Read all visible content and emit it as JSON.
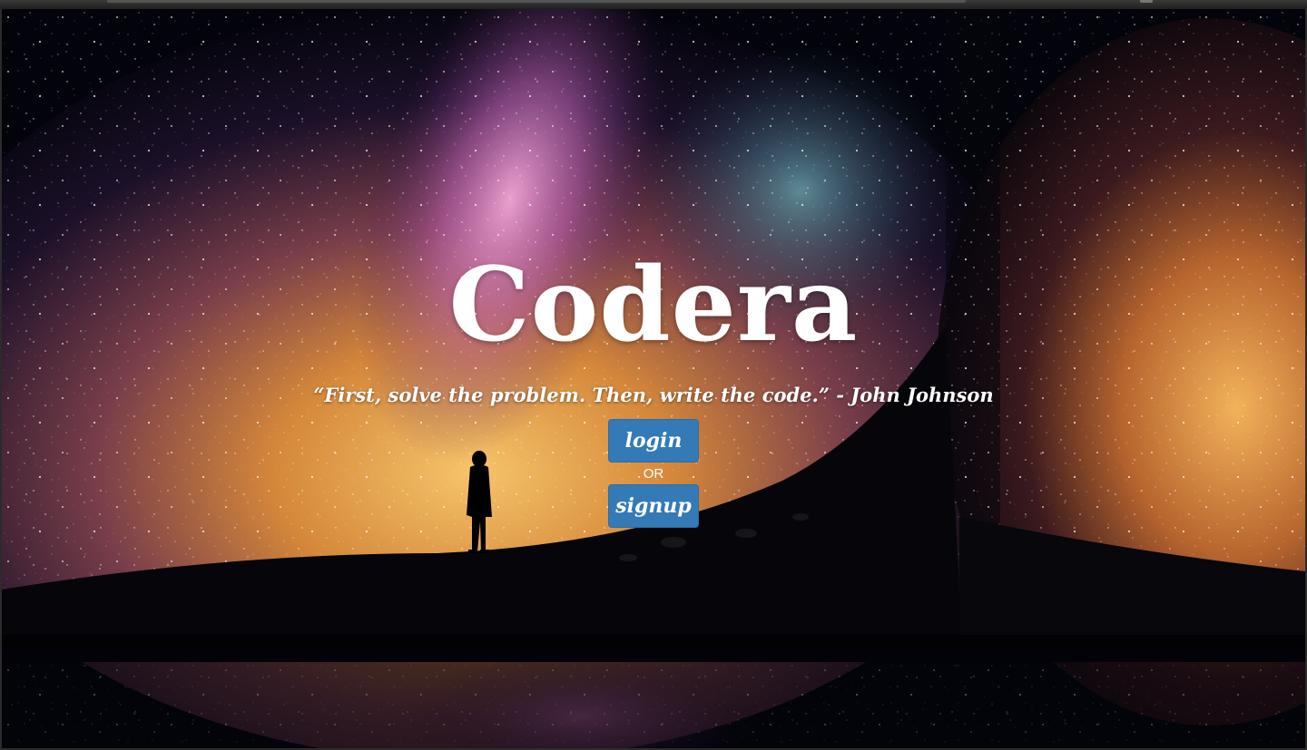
{
  "page": {
    "title": "Codera",
    "quote": "“First, solve the problem. Then, write the code.” - John Johnson",
    "login_label": "login",
    "or_label": "OR",
    "signup_label": "signup"
  },
  "colors": {
    "button_bg": "#337ab7",
    "button_border": "#2e6da4",
    "text": "#ffffff"
  }
}
